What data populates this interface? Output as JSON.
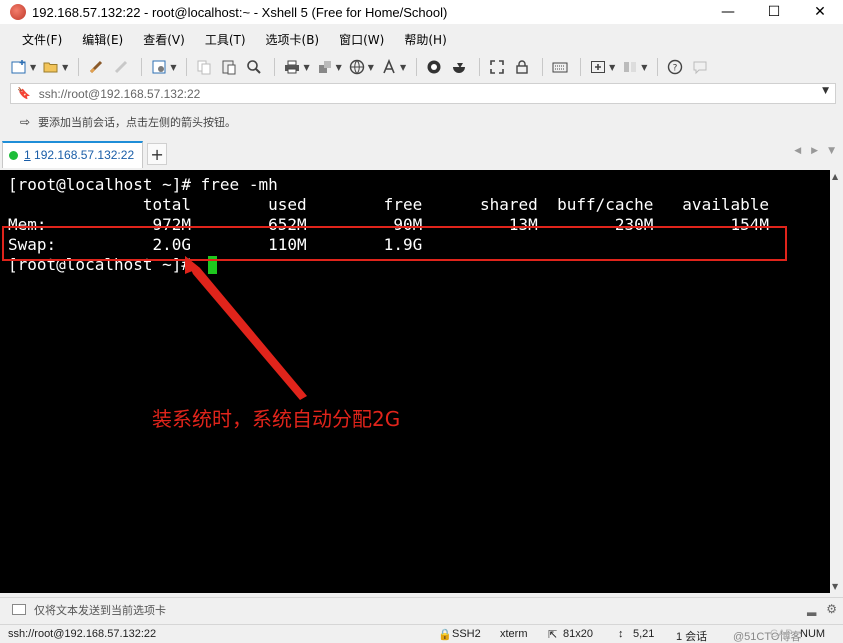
{
  "window": {
    "title": "192.168.57.132:22 - root@localhost:~ - Xshell 5 (Free for Home/School)",
    "minimize": "—",
    "maximize": "☐",
    "close": "✕"
  },
  "menu": [
    "文件(F)",
    "编辑(E)",
    "查看(V)",
    "工具(T)",
    "选项卡(B)",
    "窗口(W)",
    "帮助(H)"
  ],
  "address": {
    "value": "ssh://root@192.168.57.132:22"
  },
  "hint": {
    "text": "要添加当前会话，点击左侧的箭头按钮。"
  },
  "tab": {
    "number": "1",
    "label": " 192.168.57.132:22",
    "add": "+"
  },
  "terminal": {
    "lines": [
      "[root@localhost ~]# free -mh",
      "              total        used        free      shared  buff/cache   available",
      "Mem:           972M        652M         90M         13M        230M        154M",
      "Swap:          2.0G        110M        1.9G",
      "[root@localhost ~]# "
    ],
    "bg_color": "#000000",
    "fg_color": "#ffffff",
    "cursor_color": "#1ec81e"
  },
  "annotation": {
    "text": "装系统时，系统自动分配2G",
    "color": "#e0241b"
  },
  "send_bar": {
    "text": "仅将文本发送到当前选项卡"
  },
  "status": {
    "address": "ssh://root@192.168.57.132:22",
    "protocol": "SSH2",
    "term": "xterm",
    "size": "81x20",
    "position": "5,21",
    "sessions": "1 会话",
    "caps": "CAP",
    "num": "NUM",
    "watermark": "@51CTO博客"
  },
  "colors": {
    "accent": "#1e8ed8",
    "connected": "#1ebd3a"
  }
}
